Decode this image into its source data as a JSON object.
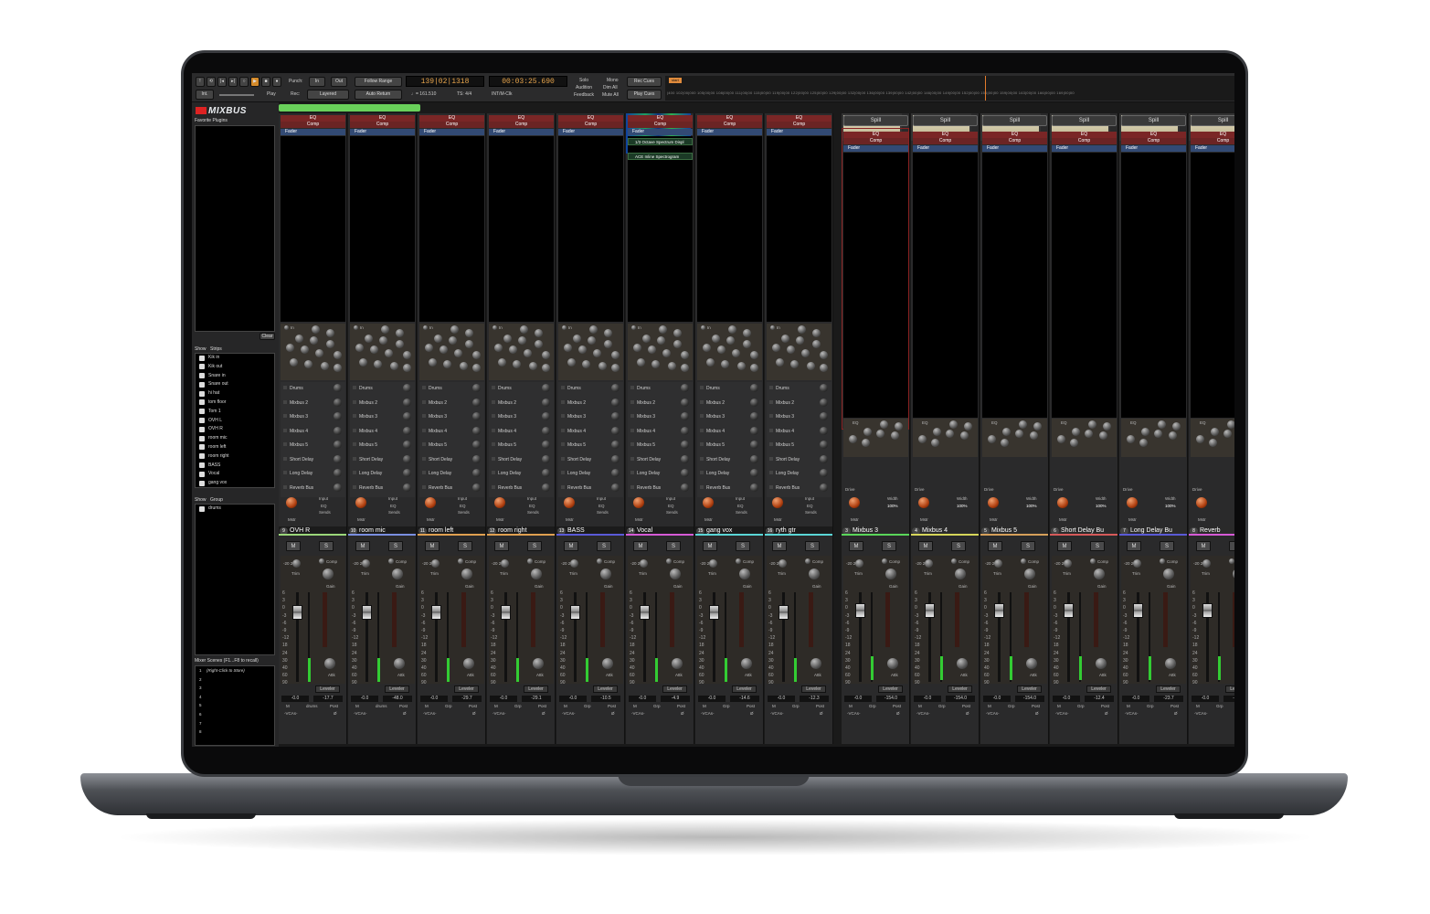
{
  "toolbar": {
    "punch_label": "Punch:",
    "punch_in": "In",
    "punch_out": "Out",
    "follow_range": "Follow Range",
    "rec_label": "Rec:",
    "rec_mode": "Layered",
    "auto_return": "Auto Return",
    "int_label": "Int.",
    "play_label": "Play",
    "bbt": "139|02|1318",
    "timecode": "00:03:25.690",
    "tempo": "♩= 161.510",
    "ts": "TS: 4/4",
    "sync": "INT/M-Clk",
    "solo": "Solo",
    "audition": "Audition",
    "feedback": "Feedback",
    "mono": "Mono",
    "dim_all": "Dim All",
    "mute_all": "Mute All",
    "rec_cues": "Rec Cues",
    "play_cues": "Play Cues",
    "marker": "start",
    "ruler": "|400 102|00|000 105|00|00 108|00|00 111|00|00 115|00|00 119|00|00 122|00|00 125|00|00 129|00|00 132|00|00 136|00|00 139|00|00 142|00|00 146|00|00 149|00|00 152|00|00 156|00|00 159|00|00 163|00|00 166|00|00 169|00|00"
  },
  "sidebar": {
    "logo": "MIXBUS",
    "favorites_header": "Favorite Plugins",
    "clear_button": "Clear",
    "strips_header": {
      "show": "Show",
      "strips": "Strips"
    },
    "strips": [
      "Kik in",
      "Kik out",
      "Snare in",
      "Snare out",
      "hi hat",
      "tom floor",
      "Tom 1",
      "OVH L",
      "OVH R",
      "room mic",
      "room left",
      "room right",
      "BASS",
      "Vocal",
      "gang vox"
    ],
    "group_header": {
      "show": "Show",
      "group": "Group"
    },
    "groups": [
      "drums"
    ],
    "scenes_header": "Mixer Scenes (F1...F8 to recall)",
    "scenes_hint": "(Right-Click to Store)",
    "scene_numbers": [
      "1",
      "2",
      "3",
      "4",
      "5",
      "6",
      "7",
      "8"
    ]
  },
  "plugins": {
    "eq": "EQ",
    "comp": "Comp",
    "fader": "Fader",
    "octave": "1/3 Octave Spectrum Displ",
    "inline": "ACE Inline Spectrogram"
  },
  "sends": [
    "Drums",
    "Mixbus 2",
    "Mixbus 3",
    "Mixbus 4",
    "Mixbus 5",
    "Short Delay",
    "Long Delay",
    "Reverb Bus"
  ],
  "labels": {
    "in": "In",
    "input": "Input",
    "eq": "EQ",
    "sends": "Sends",
    "mstr": "Mstr",
    "m": "M",
    "s": "S",
    "trim": "Trim",
    "comp": "Comp",
    "gain": "Gain",
    "attk": "Attk",
    "ratio": "Ratio",
    "leveler": "Leveler",
    "comprs": "Comprs",
    "spill": "Spill",
    "drive": "Drive",
    "width": "Width",
    "width_val": "100%",
    "post": "Post",
    "grp": "Grp",
    "vcas": "-VCAs-",
    "m_small": "M",
    "phase": "Ø",
    "scale": [
      "6",
      "3",
      "0",
      "-3",
      "-6",
      "-9",
      "-12",
      "18",
      "24",
      "30",
      "40",
      "60",
      "90"
    ],
    "trim_scale": "-20   20"
  },
  "channels": [
    {
      "num": "9",
      "name": "OVH R",
      "color": "#9bd77a",
      "grp": "drums",
      "gain": "-17.7",
      "peak": "-0.0"
    },
    {
      "num": "10",
      "name": "room mic",
      "color": "#7a8fe0",
      "grp": "drums",
      "gain": "-48.0",
      "peak": "-0.0"
    },
    {
      "num": "11",
      "name": "room left",
      "color": "#e0a050",
      "grp": "Grp",
      "gain": "-29.7",
      "peak": "-0.0"
    },
    {
      "num": "12",
      "name": "room right",
      "color": "#e0a050",
      "grp": "Grp",
      "gain": "-29.1",
      "peak": "-0.0"
    },
    {
      "num": "13",
      "name": "BASS",
      "color": "#5a5ad8",
      "grp": "Grp",
      "gain": "-10.5",
      "peak": "-0.0"
    },
    {
      "num": "14",
      "name": "Vocal",
      "color": "#d65ad6",
      "grp": "Grp",
      "gain": "-4.9",
      "peak": "-0.0"
    },
    {
      "num": "15",
      "name": "gang vox",
      "color": "#5ad6d6",
      "grp": "Grp",
      "gain": "-14.6",
      "peak": "-0.0"
    },
    {
      "num": "16",
      "name": "ryth gtr",
      "color": "#5ad6d6",
      "grp": "Grp",
      "gain": "-12.3",
      "peak": "-0.0"
    }
  ],
  "buses": [
    {
      "num": "3",
      "name": "Mixbus 3",
      "color": "#5ad65a",
      "gain": "-154.0",
      "peak": "-0.0"
    },
    {
      "num": "4",
      "name": "Mixbus 4",
      "color": "#d6d65a",
      "gain": "-154.0",
      "peak": "-0.0"
    },
    {
      "num": "5",
      "name": "Mixbus 5",
      "color": "#d6a05a",
      "gain": "-154.0",
      "peak": "-0.0"
    },
    {
      "num": "6",
      "name": "Short Delay Bu",
      "color": "#d65a5a",
      "gain": "-12.4",
      "peak": "-0.0"
    },
    {
      "num": "7",
      "name": "Long Delay Bu",
      "color": "#5a5ad6",
      "gain": "-23.7",
      "peak": "-0.0"
    },
    {
      "num": "8",
      "name": "Reverb",
      "color": "#d65ad6",
      "gain": "-17.2",
      "peak": "-0.0"
    }
  ]
}
